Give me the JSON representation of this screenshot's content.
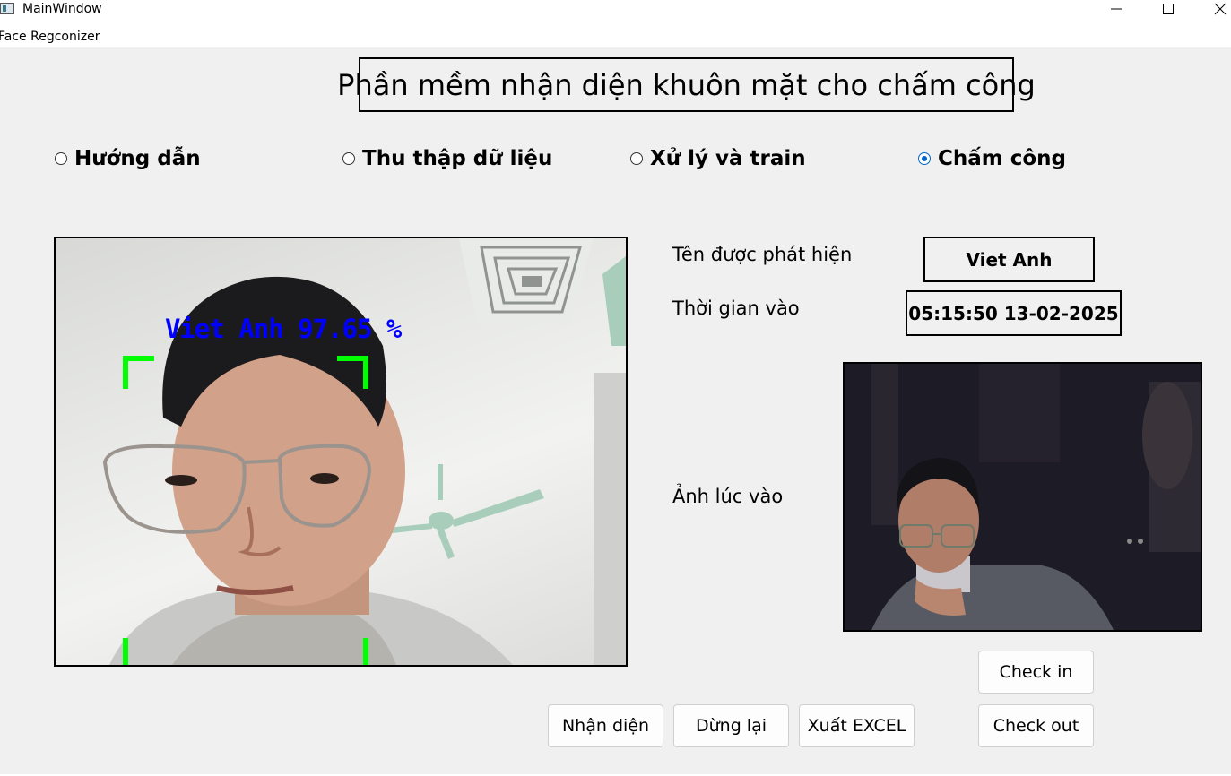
{
  "window": {
    "title": "MainWindow",
    "menu": [
      "Face Regconizer"
    ]
  },
  "header": {
    "title": "Phần mềm nhận diện khuôn mặt cho chấm công"
  },
  "modes": [
    {
      "label": "Hướng dẫn",
      "checked": false
    },
    {
      "label": "Thu thập dữ liệu",
      "checked": false
    },
    {
      "label": "Xử lý và train",
      "checked": false
    },
    {
      "label": "Chấm công",
      "checked": true
    }
  ],
  "camera": {
    "overlay_text": "Viet Anh 97.65 %",
    "overlay_color": "#0000ff",
    "box_color": "#00ff00"
  },
  "info": {
    "name_label": "Tên được phát hiện",
    "name_value": "Viet Anh",
    "time_label": "Thời gian vào",
    "time_value": "05:15:50 13-02-2025",
    "photo_label": "Ảnh lúc vào"
  },
  "buttons": {
    "recognize": "Nhận diện",
    "stop": "Dừng lại",
    "export": "Xuất EXCEL",
    "check_in": "Check in",
    "check_out": "Check out"
  },
  "colors": {
    "radio_accent": "#0064c8",
    "background": "#f0f0f0"
  }
}
